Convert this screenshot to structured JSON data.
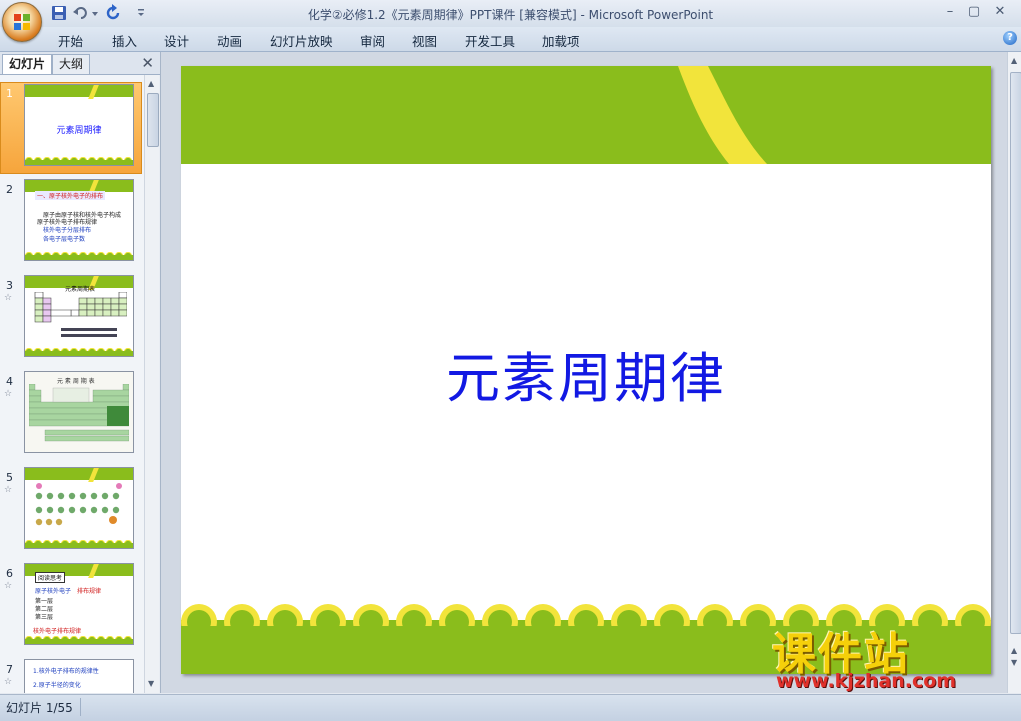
{
  "window": {
    "title": "化学②必修1.2《元素周期律》PPT课件 [兼容模式] - Microsoft PowerPoint",
    "controls": [
      "–",
      "▢",
      "✕"
    ]
  },
  "ribbon": {
    "tabs": [
      "开始",
      "插入",
      "设计",
      "动画",
      "幻灯片放映",
      "审阅",
      "视图",
      "开发工具",
      "加载项"
    ]
  },
  "left_pane": {
    "tabs": {
      "slides": "幻灯片",
      "outline": "大纲"
    },
    "close": "✕",
    "thumbnails": [
      {
        "num": "1",
        "selected": true,
        "title": "元素周期律"
      },
      {
        "num": "2",
        "header": "一、原子核外电子的排布",
        "lines": [
          "原子由原子核和核外电子构成",
          "原子核外电子排布规律",
          "核外电子分层排布",
          "各电子层电子数"
        ]
      },
      {
        "num": "3",
        "header": "元素周期表",
        "star": "☆"
      },
      {
        "num": "4",
        "header": "元 素 周 期 表",
        "star": "☆"
      },
      {
        "num": "5",
        "star": "☆"
      },
      {
        "num": "6",
        "header": "阅读思考",
        "star": "☆",
        "lines": [
          "原子核外电子",
          "排布规律",
          "第一层",
          "第二层",
          "第三层",
          "核外电子排布规律"
        ]
      },
      {
        "num": "7",
        "star": "☆",
        "lines": [
          "1.核外电子排布的规律性",
          "2.原子半径的变化"
        ]
      }
    ]
  },
  "slide": {
    "title": "元素周期律",
    "colors": {
      "green": "#8abd1c",
      "yellow": "#f2e43b",
      "title": "#1219e3"
    }
  },
  "statusbar": {
    "slide_info": "幻灯片 1/55"
  },
  "watermark": {
    "text": "课件站",
    "url": "www.kjzhan.com"
  }
}
